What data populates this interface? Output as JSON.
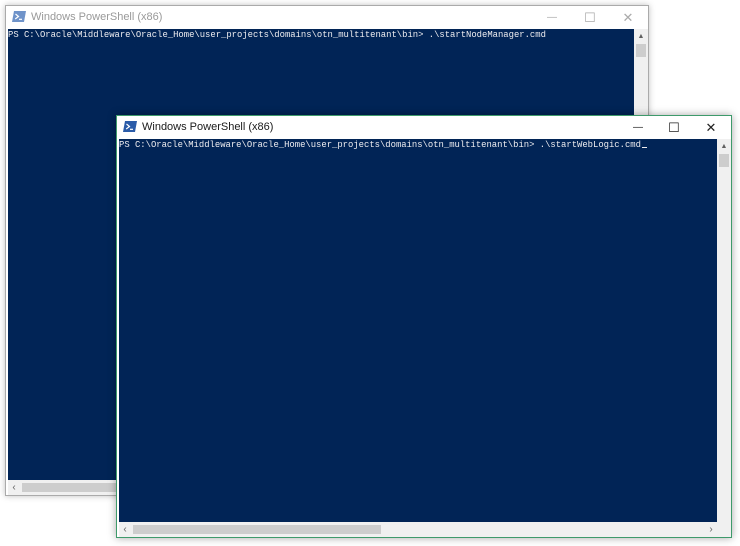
{
  "windows": {
    "back": {
      "title": "Windows PowerShell (x86)",
      "command_line": "PS C:\\Oracle\\Middleware\\Oracle_Home\\user_projects\\domains\\otn_multitenant\\bin> .\\startNodeManager.cmd"
    },
    "front": {
      "title": "Windows PowerShell (x86)",
      "command_line": "PS C:\\Oracle\\Middleware\\Oracle_Home\\user_projects\\domains\\otn_multitenant\\bin> .\\startWebLogic.cmd"
    }
  },
  "controls": {
    "minimize": "—",
    "maximize": "☐",
    "close": "✕"
  },
  "colors": {
    "console_bg": "#012456",
    "console_text": "#eeedf0",
    "active_border": "#3e9a6b"
  },
  "icons": {
    "title": "powershell-icon",
    "minimize": "minimize-icon",
    "maximize": "maximize-icon",
    "close": "close-icon"
  }
}
